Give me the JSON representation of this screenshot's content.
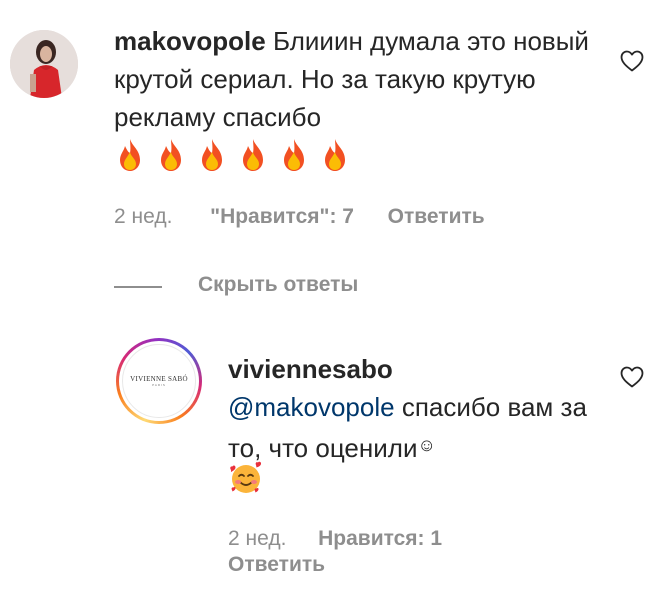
{
  "comment": {
    "username": "makovopole",
    "text": "Блииин думала это новый крутой сериал. Но за такую крутую рекламу спасибо",
    "emojis_icon": "fire-emoji-x6",
    "time": "2 нед.",
    "likes_label": "\"Нравится\": 7",
    "reply_label": "Ответить"
  },
  "replies_toggle": {
    "label": "Скрыть ответы"
  },
  "reply": {
    "username": "viviennesabo",
    "mention": "@makovopole",
    "text": " спасибо вам за то, что оценили",
    "smile": "☺",
    "emoji_icon": "smiling-face-with-hearts-emoji",
    "time": "2 нед.",
    "likes_label": "Нравится: 1",
    "reply_label": "Ответить",
    "avatar_logo": "VIVIENNE SABÓ",
    "avatar_logo_sub": "PARIS"
  },
  "colors": {
    "text": "#262626",
    "secondary": "#8e8e8e",
    "mention": "#00376b"
  }
}
